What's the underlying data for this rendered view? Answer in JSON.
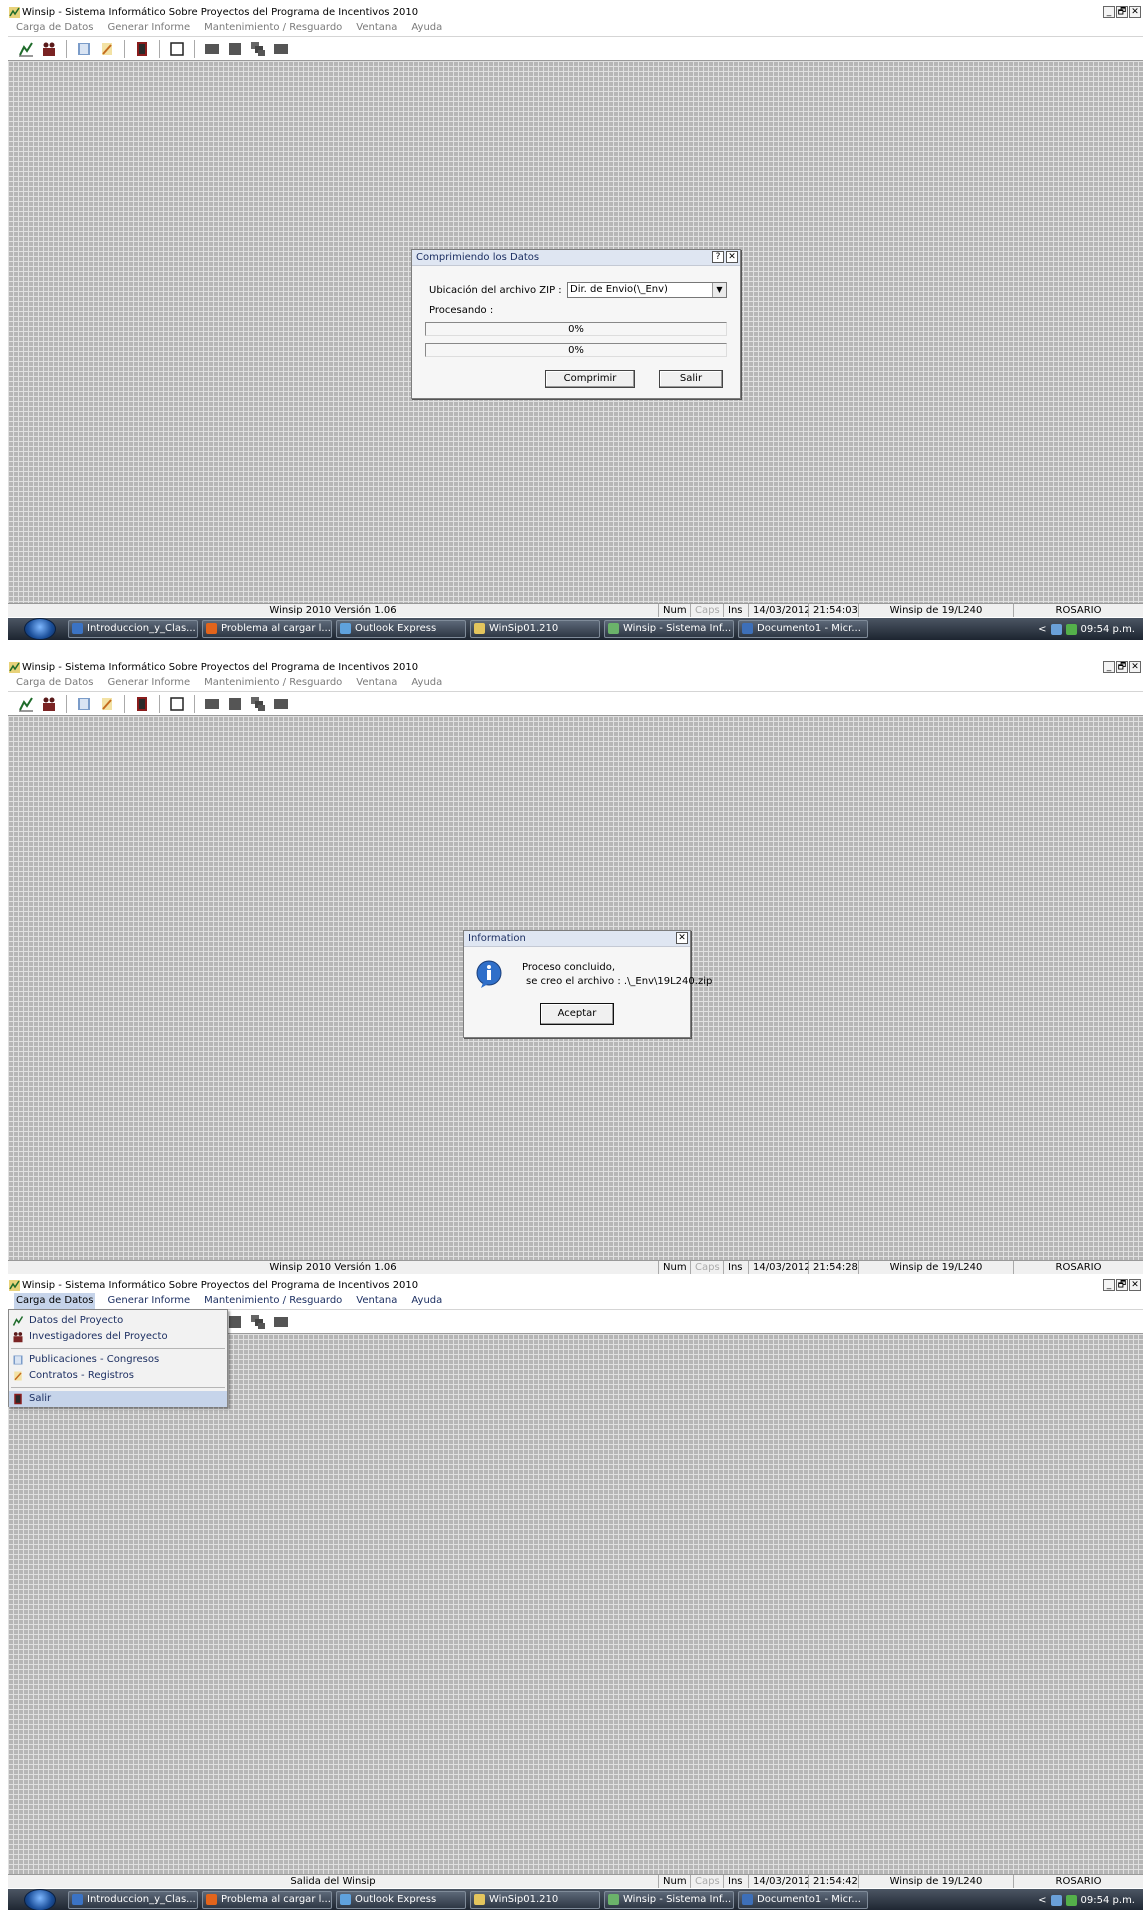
{
  "app": {
    "title": "Winsip - Sistema Informático Sobre Proyectos del Programa de Incentivos 2010",
    "window_buttons": [
      "_",
      "🗗",
      "✕"
    ]
  },
  "menu": [
    "Carga de Datos",
    "Generar Informe",
    "Mantenimiento / Resguardo",
    "Ventana",
    "Ayuda"
  ],
  "toolbar_icons": [
    "chart-icon",
    "people-icon",
    "book-icon",
    "pencil-icon",
    "door-icon",
    "window-icon",
    "grid-icon",
    "grid-icon",
    "cascade-icon",
    "grid-icon"
  ],
  "status_common": {
    "num": "Num",
    "caps": "Caps",
    "ins": "Ins",
    "date": "14/03/2012",
    "winsip_id": "Winsip de 19/L240",
    "city": "ROSARIO"
  },
  "screens": [
    {
      "status_text": "Winsip 2010 Versión 1.06",
      "time": "21:54:03"
    },
    {
      "status_text": "Winsip 2010 Versión 1.06",
      "time": "21:54:28"
    },
    {
      "status_text": "Salida del Winsip",
      "time": "21:54:42"
    }
  ],
  "taskbar": {
    "tasks": [
      "Introduccion_y_Clas...",
      "Problema al cargar l...",
      "Outlook Express",
      "WinSip01.210",
      "Winsip - Sistema Inf...",
      "Documento1 - Micr..."
    ],
    "clock": "09:54 p.m.",
    "tray_arrow": "<"
  },
  "compress_dialog": {
    "title": "Comprimiendo los Datos",
    "help": "?",
    "close": "✕",
    "zip_label": "Ubicación del archivo ZIP :",
    "zip_value": "Dir. de Envio(\\_Env)",
    "processing_label": "Procesando :",
    "progress1": "0%",
    "progress2": "0%",
    "compress_button": "Comprimir",
    "exit_button": "Salir"
  },
  "info_dialog": {
    "title": "Information",
    "close": "✕",
    "line1": "Proceso concluido,",
    "line2": "se creo el archivo : .\\_Env\\19L240.zip",
    "ok_button": "Aceptar"
  },
  "carga_menu": {
    "items": [
      "Datos del Proyecto",
      "Investigadores del Proyecto",
      "Publicaciones - Congresos",
      "Contratos - Registros",
      "Salir"
    ]
  }
}
